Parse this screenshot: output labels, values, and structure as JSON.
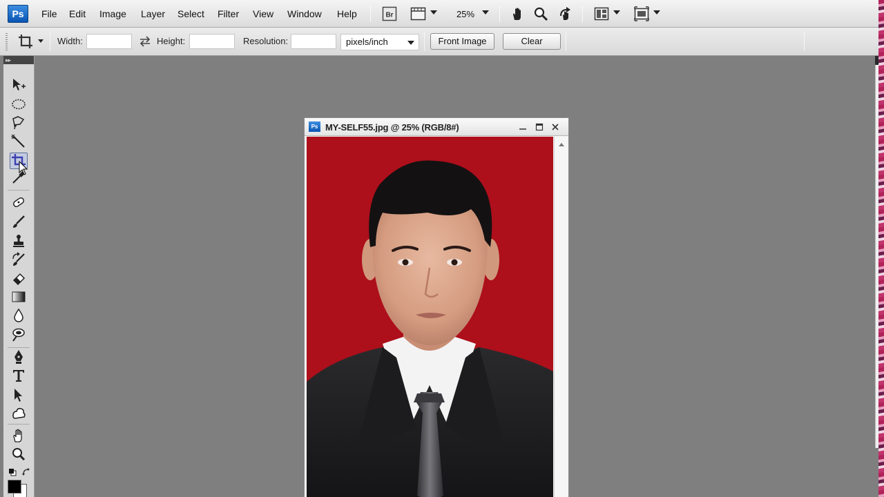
{
  "app": {
    "logo_text": "Ps",
    "brand_color": "#0a55b4"
  },
  "menubar": {
    "items": [
      "File",
      "Edit",
      "Image",
      "Layer",
      "Select",
      "Filter",
      "View",
      "Window",
      "Help"
    ],
    "bridge_label": "Br",
    "zoom_level": "25%",
    "icons": [
      "bridge-icon",
      "view-extras-icon",
      "zoom-level-dropdown",
      "hand-icon",
      "zoom-icon",
      "rotate-view-icon",
      "arrange-documents-icon",
      "screen-mode-icon"
    ]
  },
  "options": {
    "width_label": "Width:",
    "width_value": "",
    "height_label": "Height:",
    "height_value": "",
    "resolution_label": "Resolution:",
    "resolution_value": "",
    "unit": "pixels/inch",
    "front_image_label": "Front Image",
    "clear_label": "Clear"
  },
  "toolbox": {
    "header": "▸▸",
    "active_tool": "crop-tool",
    "tools": [
      "move-tool",
      "elliptical-marquee-tool",
      "lasso-tool",
      "magic-wand-tool",
      "crop-tool",
      "eyedropper-tool",
      "spot-healing-tool",
      "brush-tool",
      "clone-stamp-tool",
      "history-brush-tool",
      "eraser-tool",
      "gradient-tool",
      "blur-tool",
      "dodge-tool",
      "pen-tool",
      "type-tool",
      "path-selection-tool",
      "custom-shape-tool",
      "hand-tool",
      "zoom-tool"
    ],
    "foreground_color": "#000000",
    "background_color": "#ffffff"
  },
  "document": {
    "title": "MY-SELF55.jpg @ 25% (RGB/8#)",
    "ps_badge": "Ps",
    "canvas_background": "#ad0f1b"
  }
}
